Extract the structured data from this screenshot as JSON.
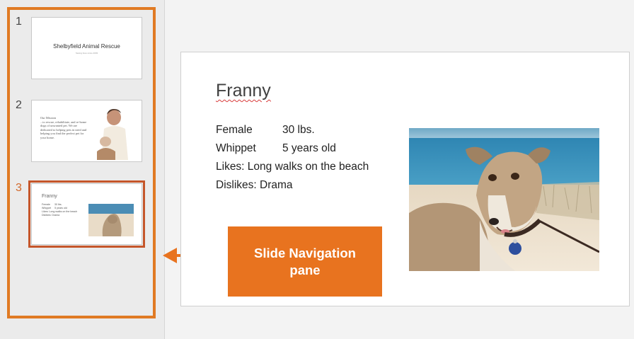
{
  "nav_pane": {
    "slides": [
      {
        "number": "1",
        "title": "Shelbyfield Animal Rescue",
        "subtitle": "Saving lives since 2003"
      },
      {
        "number": "2",
        "title": "Our Mission",
        "body": "...to rescue, rehabilitate, and re-home dogs of unwanted pet. We are dedicated to helping pets in need and helping you find the perfect pet for your home."
      },
      {
        "number": "3",
        "title": "Franny",
        "lines": "Female      30 lbs.\nWhippet     5 years old\nLikes: Long walks on the beach\nDislikes: Drama"
      }
    ]
  },
  "main_slide": {
    "title": "Franny",
    "rows": [
      {
        "col1": "Female",
        "col2": "30 lbs."
      },
      {
        "col1": "Whippet",
        "col2": "5 years old"
      }
    ],
    "likes": "Likes: Long walks on the beach",
    "dislikes": "Dislikes: Drama"
  },
  "callout": {
    "line1": "Slide Navigation",
    "line2": "pane",
    "color": "#e8731f"
  }
}
